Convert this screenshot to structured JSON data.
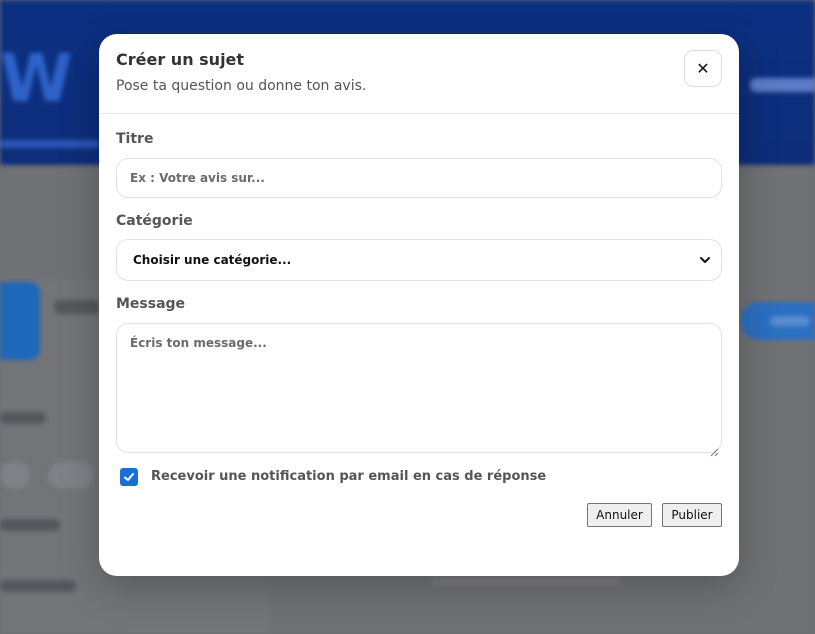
{
  "background": {
    "logo_text": "W"
  },
  "modal": {
    "title": "Créer un sujet",
    "subtitle": "Pose ta question ou donne ton avis.",
    "close_icon": "close-icon"
  },
  "form": {
    "title_label": "Titre",
    "title_placeholder": "Ex : Votre avis sur...",
    "title_value": "",
    "category_label": "Catégorie",
    "category_selected": "Choisir une catégorie...",
    "message_label": "Message",
    "message_placeholder": "Écris ton message...",
    "message_value": "",
    "notify_checked": true,
    "notify_label": "Recevoir une notification par email en cas de réponse"
  },
  "actions": {
    "cancel_label": "Annuler",
    "publish_label": "Publier"
  },
  "colors": {
    "accent": "#1a6fd6",
    "header_bg": "#0b2f82",
    "overlay": "#6d6e72"
  }
}
